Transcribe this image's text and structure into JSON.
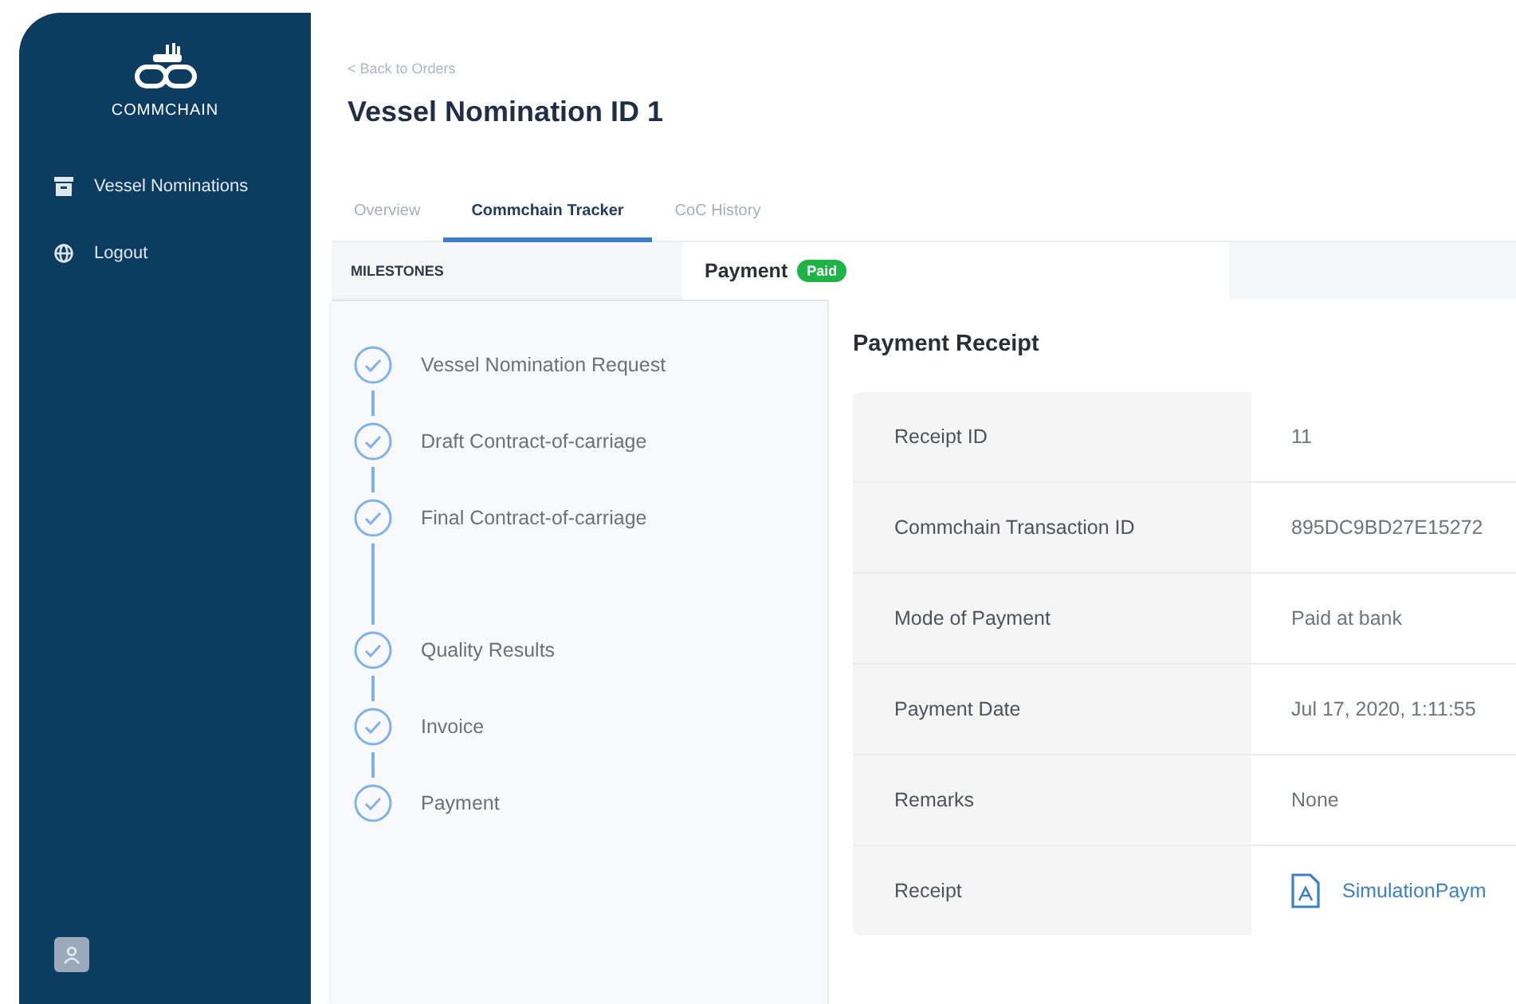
{
  "sidebar": {
    "logo_text": "COMMCHAIN",
    "items": [
      {
        "label": "Vessel Nominations",
        "kind": "archive"
      },
      {
        "label": "Logout",
        "kind": "globe"
      }
    ]
  },
  "header": {
    "back_link": "< Back to Orders",
    "title": "Vessel Nomination ID 1"
  },
  "tabs": [
    {
      "label": "Overview",
      "selected": false
    },
    {
      "label": "Commchain Tracker",
      "selected": true
    },
    {
      "label": "CoC History",
      "selected": false
    }
  ],
  "milestones": {
    "heading": "MILESTONES",
    "items": [
      {
        "label": "Vessel Nomination Request",
        "completed": true
      },
      {
        "label": "Draft Contract-of-carriage",
        "completed": true
      },
      {
        "label": "Final Contract-of-carriage",
        "completed": true
      },
      {
        "label": "Quality Results",
        "completed": true
      },
      {
        "label": "Invoice",
        "completed": true
      },
      {
        "label": "Payment",
        "completed": true
      }
    ]
  },
  "detail": {
    "heading": "Payment",
    "status": "Paid",
    "section_title": "Payment Receipt",
    "rows": [
      {
        "label": "Receipt ID",
        "value": "11",
        "kind": "text"
      },
      {
        "label": "Commchain Transaction ID",
        "value": "895DC9BD27E15272",
        "kind": "text"
      },
      {
        "label": "Mode of Payment",
        "value": "Paid at bank",
        "kind": "text"
      },
      {
        "label": "Payment Date",
        "value": "Jul 17, 2020, 1:11:55",
        "kind": "text"
      },
      {
        "label": "Remarks",
        "value": "None",
        "kind": "text"
      },
      {
        "label": "Receipt",
        "value": "SimulationPaym",
        "kind": "file"
      }
    ]
  }
}
